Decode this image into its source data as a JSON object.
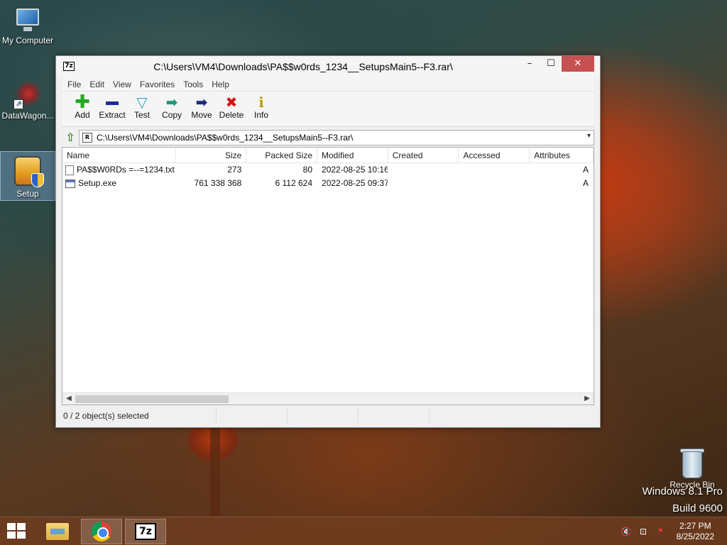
{
  "desktop": {
    "icons": [
      {
        "label": "My Computer"
      },
      {
        "label": "DataWagon..."
      },
      {
        "label": "Setup"
      },
      {
        "label": "Recycle Bin"
      }
    ],
    "watermark": {
      "line1": "Windows 8.1 Pro",
      "line2": "Build 9600"
    }
  },
  "window": {
    "title": "C:\\Users\\VM4\\Downloads\\PA$$w0rds_1234__SetupsMain5--F3.rar\\",
    "app_icon": "7z",
    "controls": {
      "minimize": "–",
      "maximize": "☐",
      "close": "✕"
    },
    "menu": [
      "File",
      "Edit",
      "View",
      "Favorites",
      "Tools",
      "Help"
    ],
    "toolbar": [
      {
        "label": "Add",
        "icon": "plus-icon",
        "color": "#22aa22"
      },
      {
        "label": "Extract",
        "icon": "minus-icon",
        "color": "#1a2aa0"
      },
      {
        "label": "Test",
        "icon": "check-icon",
        "color": "#2aaac8"
      },
      {
        "label": "Copy",
        "icon": "copy-arrow-icon",
        "color": "#1a9a7a"
      },
      {
        "label": "Move",
        "icon": "move-arrow-icon",
        "color": "#1a2a80"
      },
      {
        "label": "Delete",
        "icon": "delete-x-icon",
        "color": "#d01818"
      },
      {
        "label": "Info",
        "icon": "info-icon",
        "color": "#b8a000"
      }
    ],
    "address": {
      "path": "C:\\Users\\VM4\\Downloads\\PA$$w0rds_1234__SetupsMain5--F3.rar\\"
    },
    "columns": [
      "Name",
      "Size",
      "Packed Size",
      "Modified",
      "Created",
      "Accessed",
      "Attributes"
    ],
    "rows": [
      {
        "name": "PA$$W0RDs =--=1234.txt",
        "size": "273",
        "packed": "80",
        "modified": "2022-08-25 10:16",
        "created": "",
        "accessed": "",
        "attr": "A",
        "type": "txt"
      },
      {
        "name": "Setup.exe",
        "size": "761 338 368",
        "packed": "6 112 624",
        "modified": "2022-08-25 09:37",
        "created": "",
        "accessed": "",
        "attr": "A",
        "type": "exe"
      }
    ],
    "status": {
      "selection": "0 / 2 object(s) selected"
    }
  },
  "taskbar": {
    "clock": {
      "time": "2:27 PM",
      "date": "8/25/2022"
    }
  }
}
